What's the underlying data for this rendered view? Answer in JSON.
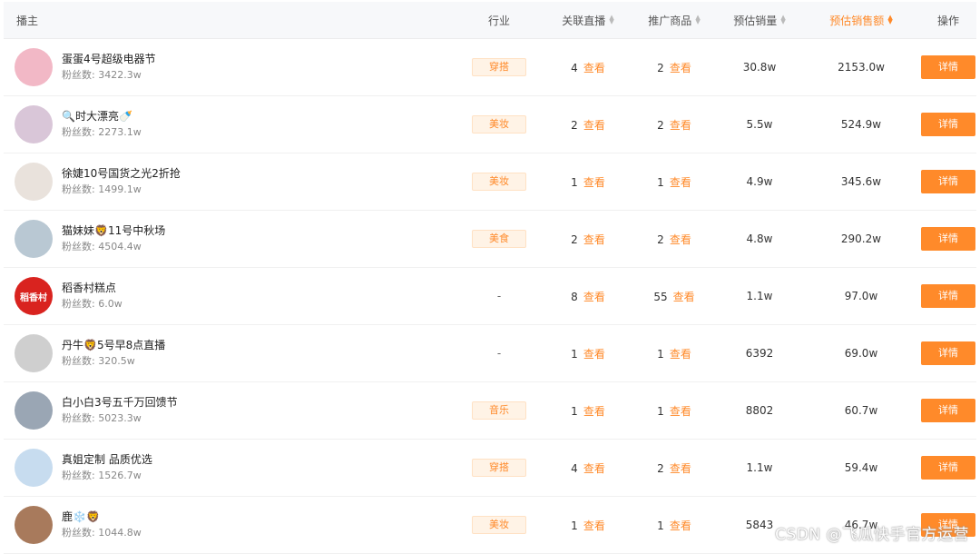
{
  "header": {
    "host": "播主",
    "industry": "行业",
    "live": "关联直播",
    "products": "推广商品",
    "sales": "预估销量",
    "gmv": "预估销售额",
    "op": "操作"
  },
  "rows": [
    {
      "name": "蛋蛋4号超级电器节",
      "fans": "粉丝数: 3422.3w",
      "industry": "穿搭",
      "live": "4",
      "products": "2",
      "sales": "30.8w",
      "gmv": "2153.0w",
      "avatar_color": "#f2b8c6"
    },
    {
      "name": "🔍时大漂亮🍼",
      "fans": "粉丝数: 2273.1w",
      "industry": "美妆",
      "live": "2",
      "products": "2",
      "sales": "5.5w",
      "gmv": "524.9w",
      "avatar_color": "#d9c6d8"
    },
    {
      "name": "徐婕10号国货之光2折抢",
      "fans": "粉丝数: 1499.1w",
      "industry": "美妆",
      "live": "1",
      "products": "1",
      "sales": "4.9w",
      "gmv": "345.6w",
      "avatar_color": "#e9e2dc"
    },
    {
      "name": "猫妹妹🦁11号中秋场",
      "fans": "粉丝数: 4504.4w",
      "industry": "美食",
      "live": "2",
      "products": "2",
      "sales": "4.8w",
      "gmv": "290.2w",
      "avatar_color": "#b9c8d3"
    },
    {
      "name": "稻香村糕点",
      "fans": "粉丝数: 6.0w",
      "industry": "-",
      "live": "8",
      "products": "55",
      "sales": "1.1w",
      "gmv": "97.0w",
      "avatar_color": "#d9231f",
      "avatar_text": "稻香村"
    },
    {
      "name": "丹牛🦁5号早8点直播",
      "fans": "粉丝数: 320.5w",
      "industry": "-",
      "live": "1",
      "products": "1",
      "sales": "6392",
      "gmv": "69.0w",
      "avatar_color": "#cfcfcf"
    },
    {
      "name": "白小白3号五千万回馈节",
      "fans": "粉丝数: 5023.3w",
      "industry": "音乐",
      "live": "1",
      "products": "1",
      "sales": "8802",
      "gmv": "60.7w",
      "avatar_color": "#9aa6b4"
    },
    {
      "name": "真姐定制 品质优选",
      "fans": "粉丝数: 1526.7w",
      "industry": "穿搭",
      "live": "4",
      "products": "2",
      "sales": "1.1w",
      "gmv": "59.4w",
      "avatar_color": "#c7dcef"
    },
    {
      "name": "鹿❄️🦁",
      "fans": "粉丝数: 1044.8w",
      "industry": "美妆",
      "live": "1",
      "products": "1",
      "sales": "5843",
      "gmv": "46.7w",
      "avatar_color": "#a87a5c"
    }
  ],
  "view_label": "查看",
  "detail_label": "详情",
  "watermark": "CSDN @飞瓜快手官方运营",
  "colors": {
    "accent": "#ff8a2a",
    "tag_bg": "#fff3e6",
    "header_bg": "#f7f8fa"
  }
}
